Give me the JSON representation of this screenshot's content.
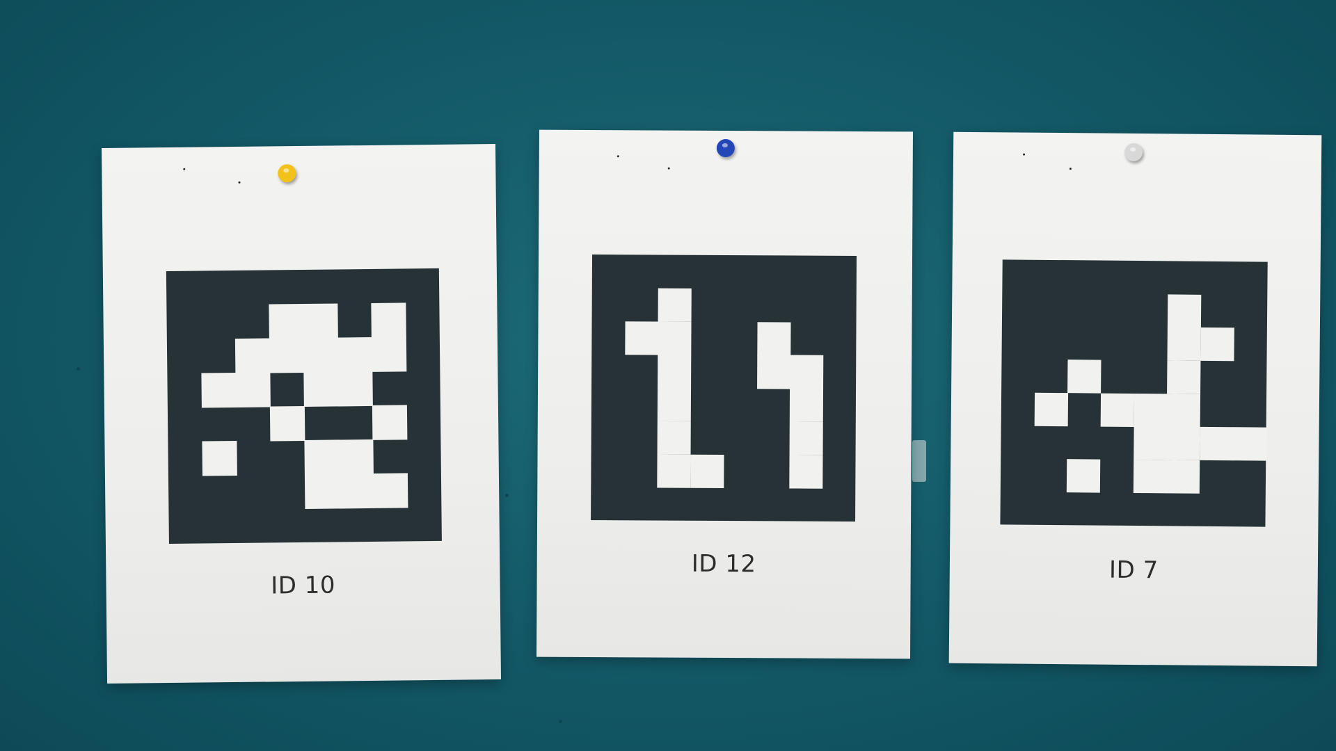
{
  "colors": {
    "wall": "#135866",
    "paper": "#f0f0ee",
    "marker": "#263236"
  },
  "sheets": [
    {
      "label": "ID 10",
      "pin_color": "#f2c21a",
      "grid": [
        "00000000",
        "00011010",
        "00111110",
        "01101100",
        "00010010",
        "01001100",
        "00001110",
        "00000000"
      ]
    },
    {
      "label": "ID 12",
      "pin_color": "#2346b8",
      "grid": [
        "00000000",
        "00100000",
        "01100100",
        "00100110",
        "00100010",
        "00100010",
        "00110010",
        "00000000"
      ]
    },
    {
      "label": "ID 7",
      "pin_color": "#d8d8d8",
      "grid": [
        "00000000",
        "00000100",
        "00000110",
        "00100100",
        "01011100",
        "00001111",
        "00101100",
        "00000000"
      ]
    }
  ]
}
